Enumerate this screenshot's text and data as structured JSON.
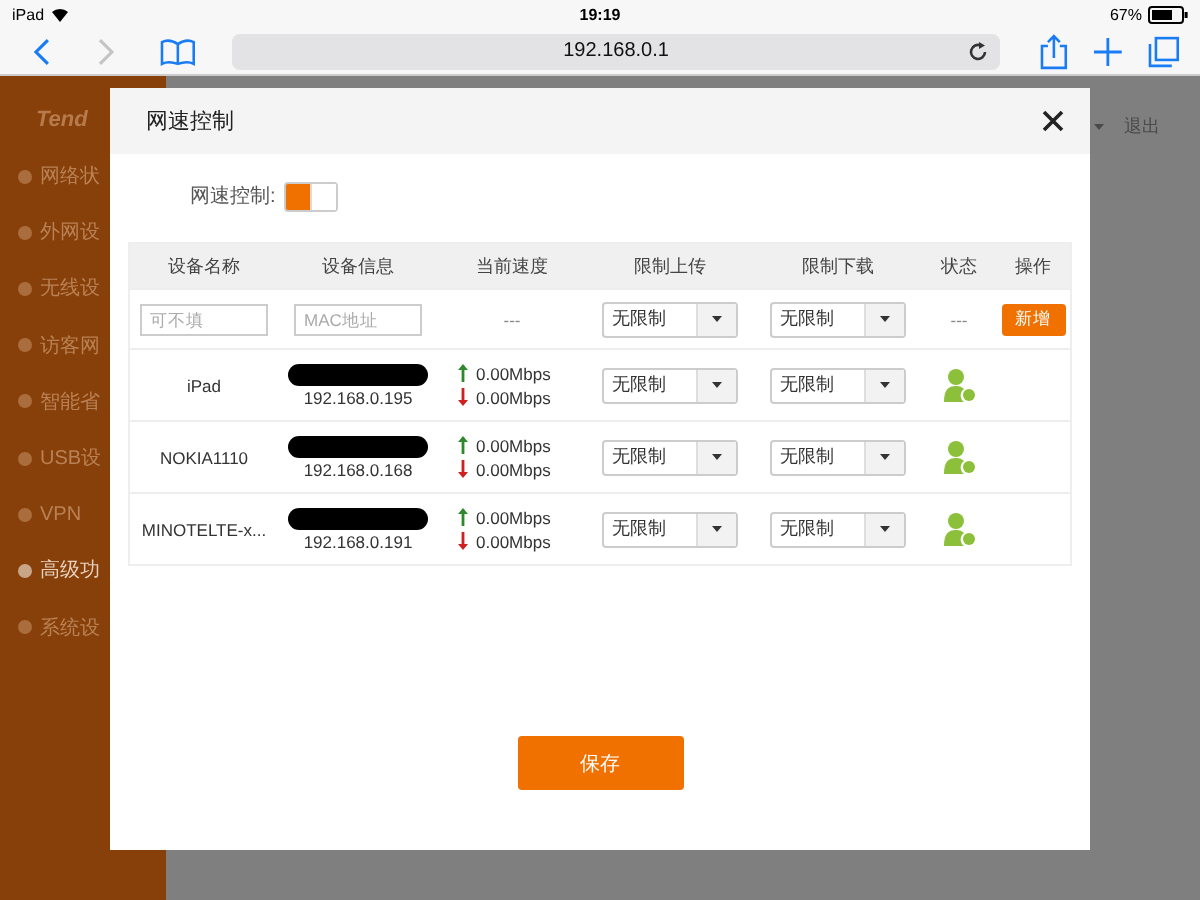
{
  "status_bar": {
    "device": "iPad",
    "time": "19:19",
    "battery": "67%"
  },
  "browser": {
    "back_enabled": true,
    "forward_enabled": false,
    "url": "192.168.0.1"
  },
  "sidebar": {
    "logo": "Tend",
    "items": [
      {
        "label": "网络状",
        "selected": false
      },
      {
        "label": "外网设",
        "selected": false
      },
      {
        "label": "无线设",
        "selected": false
      },
      {
        "label": "访客网",
        "selected": false
      },
      {
        "label": "智能省",
        "selected": false
      },
      {
        "label": "USB设",
        "selected": false
      },
      {
        "label": "VPN",
        "selected": false
      },
      {
        "label": "高级功",
        "selected": true
      },
      {
        "label": "系统设",
        "selected": false
      }
    ]
  },
  "header": {
    "logout": "退出"
  },
  "dialog": {
    "title": "网速控制",
    "toggle": {
      "label": "网速控制:",
      "on": true
    },
    "columns": [
      "设备名称",
      "设备信息",
      "当前速度",
      "限制上传",
      "限制下载",
      "状态",
      "操作"
    ],
    "new_row": {
      "name_placeholder": "可不填",
      "mac_placeholder": "MAC地址",
      "speed": "---",
      "upload": "无限制",
      "download": "无限制",
      "status": "---",
      "action": "新增"
    },
    "rows": [
      {
        "name": "iPad",
        "ip": "192.168.0.195",
        "up": "0.00Mbps",
        "down": "0.00Mbps",
        "upload": "无限制",
        "download": "无限制"
      },
      {
        "name": "NOKIA1110",
        "ip": "192.168.0.168",
        "up": "0.00Mbps",
        "down": "0.00Mbps",
        "upload": "无限制",
        "download": "无限制"
      },
      {
        "name": "MINOTELTE-x...",
        "ip": "192.168.0.191",
        "up": "0.00Mbps",
        "down": "0.00Mbps",
        "upload": "无限制",
        "download": "无限制"
      }
    ],
    "save": "保存"
  }
}
